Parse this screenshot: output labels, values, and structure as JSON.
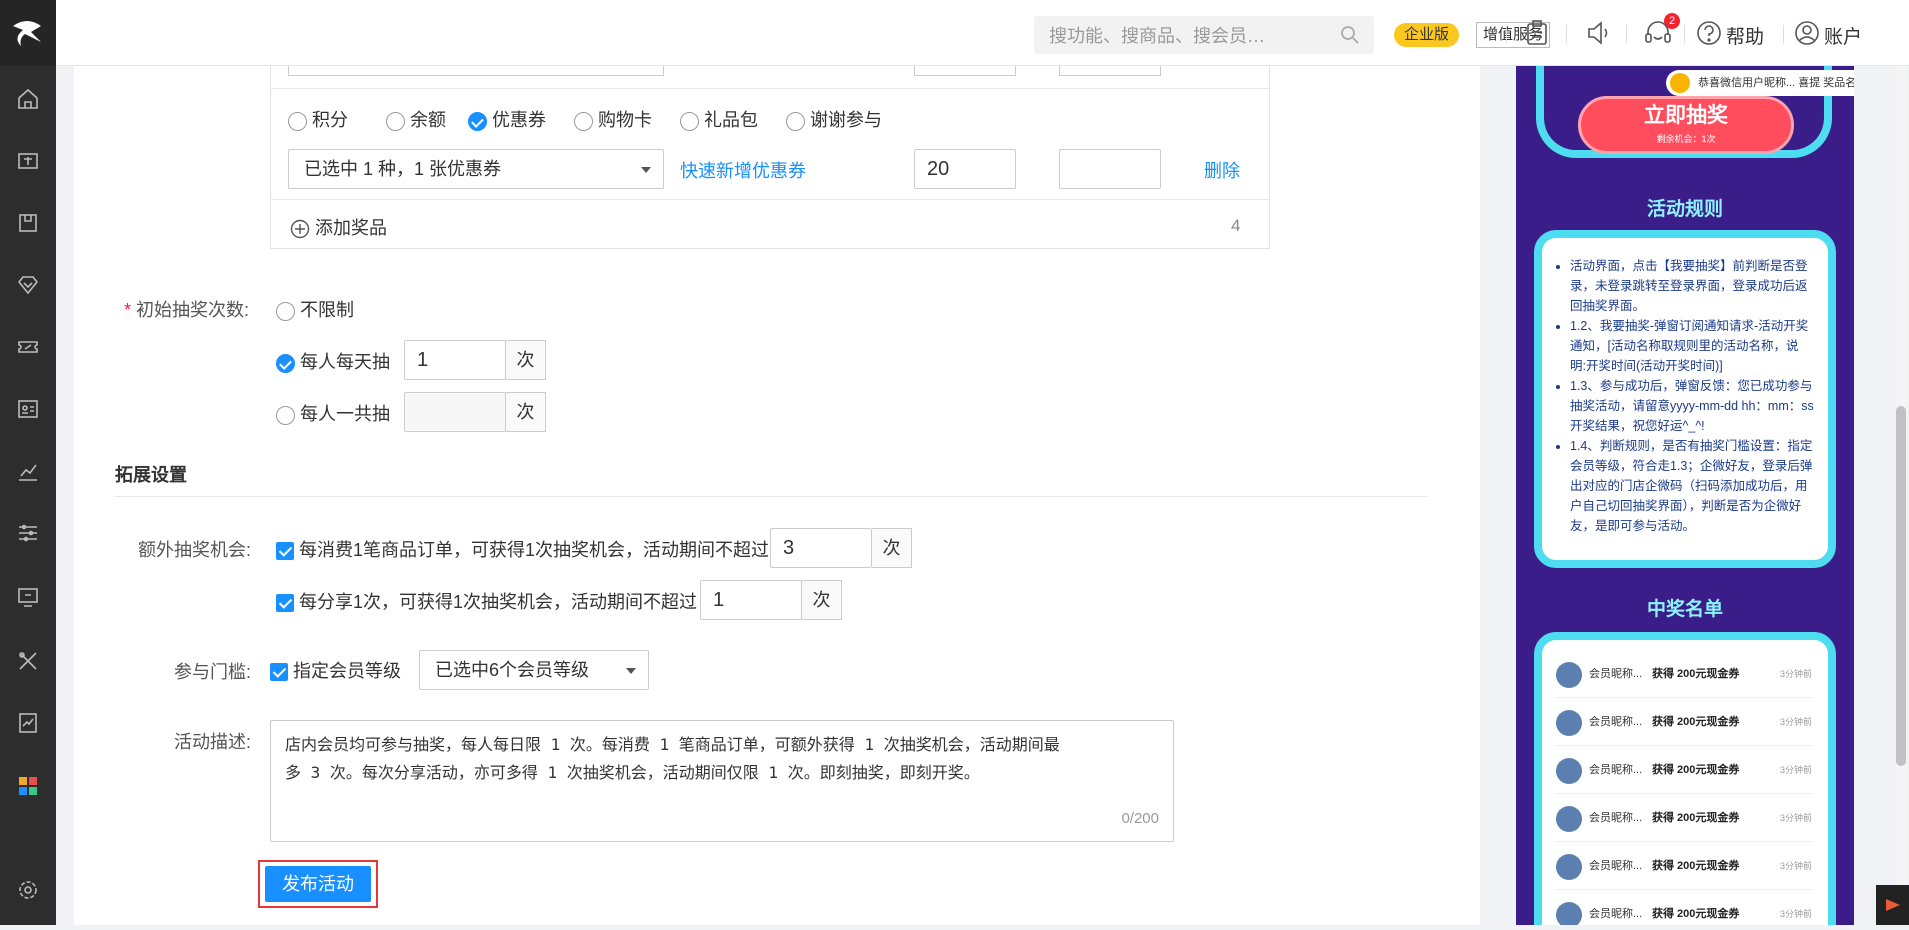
{
  "topbar": {
    "search_placeholder": "搜功能、搜商品、搜会员…",
    "enterprise_badge": "企业版",
    "value_added_service": "增值服务",
    "notification_count": "2",
    "help": "帮助",
    "account": "账户"
  },
  "prizes": {
    "types": [
      "积分",
      "余额",
      "优惠券",
      "购物卡",
      "礼品包",
      "谢谢参与"
    ],
    "selected_type": "优惠券",
    "coupon_select": "已选中 1 种，1 张优惠券",
    "quick_add_link": "快速新增优惠券",
    "quantity": "20",
    "delete": "删除",
    "add_prize": "添加奖品",
    "prize_count": "4"
  },
  "initial_draws": {
    "label": "初始抽奖次数:",
    "required_mark": "*",
    "options": [
      "不限制",
      "每人每天抽",
      "每人一共抽"
    ],
    "daily_value": "1",
    "unit": "次"
  },
  "extension": {
    "section_title": "拓展设置",
    "extra_label": "额外抽奖机会:",
    "extra_order_text": "每消费1笔商品订单，可获得1次抽奖机会，活动期间不超过",
    "extra_order_value": "3",
    "extra_share_text": "每分享1次，可获得1次抽奖机会，活动期间不超过",
    "extra_share_value": "1",
    "unit": "次",
    "threshold_label": "参与门槛:",
    "member_level_text": "指定会员等级",
    "member_level_select": "已选中6个会员等级",
    "description_label": "活动描述:",
    "description_line1": "店内会员均可参与抽奖，每人每日限 1 次。每消费 1 笔商品订单，可额外获得 1 次抽奖机会，活动期间最",
    "description_line2": "多 3 次。每次分享活动，亦可多得 1 次抽奖机会，活动期间仅限 1 次。即刻抽奖，即刻开奖。",
    "description_count": "0/200"
  },
  "publish_button": "发布活动",
  "preview": {
    "marquee": "恭喜微信用户昵称... 喜提 奖品名",
    "draw_button": "立即抽奖",
    "draw_sub": "剩余机会：1次",
    "rules_title": "活动规则",
    "rules": [
      "活动界面，点击【我要抽奖】前判断是否登录，未登录跳转至登录界面，登录成功后返回抽奖界面。",
      "1.2、我要抽奖-弹窗订阅通知请求-活动开奖通知，[活动名称取规则里的活动名称，说明:开奖时间(活动开奖时间)]",
      "1.3、参与成功后，弹窗反馈：您已成功参与抽奖活动，请留意yyyy-mm-dd hh：mm：ss开奖结果，祝您好运^_^!",
      "1.4、判断规则，是否有抽奖门槛设置：指定会员等级，符合走1.3；企微好友，登录后弹出对应的门店企微码（扫码添加成功后，用户自己切回抽奖界面），判断是否为企微好友，是即可参与活动。"
    ],
    "winners_title": "中奖名单",
    "winners": [
      {
        "name": "会员昵称...",
        "prize": "获得 200元现金券",
        "time": "3分钟前"
      },
      {
        "name": "会员昵称...",
        "prize": "获得 200元现金券",
        "time": "3分钟前"
      },
      {
        "name": "会员昵称...",
        "prize": "获得 200元现金券",
        "time": "3分钟前"
      },
      {
        "name": "会员昵称...",
        "prize": "获得 200元现金券",
        "time": "3分钟前"
      },
      {
        "name": "会员昵称...",
        "prize": "获得 200元现金券",
        "time": "3分钟前"
      },
      {
        "name": "会员昵称...",
        "prize": "获得 200元现金券",
        "time": "3分钟前"
      }
    ]
  },
  "colors": {
    "primary": "#1890ff",
    "sidebar": "#2d2d2d",
    "enterprise": "#fcc81f",
    "preview_bg": "#3a1d88",
    "preview_frame": "#4ddcf0"
  }
}
